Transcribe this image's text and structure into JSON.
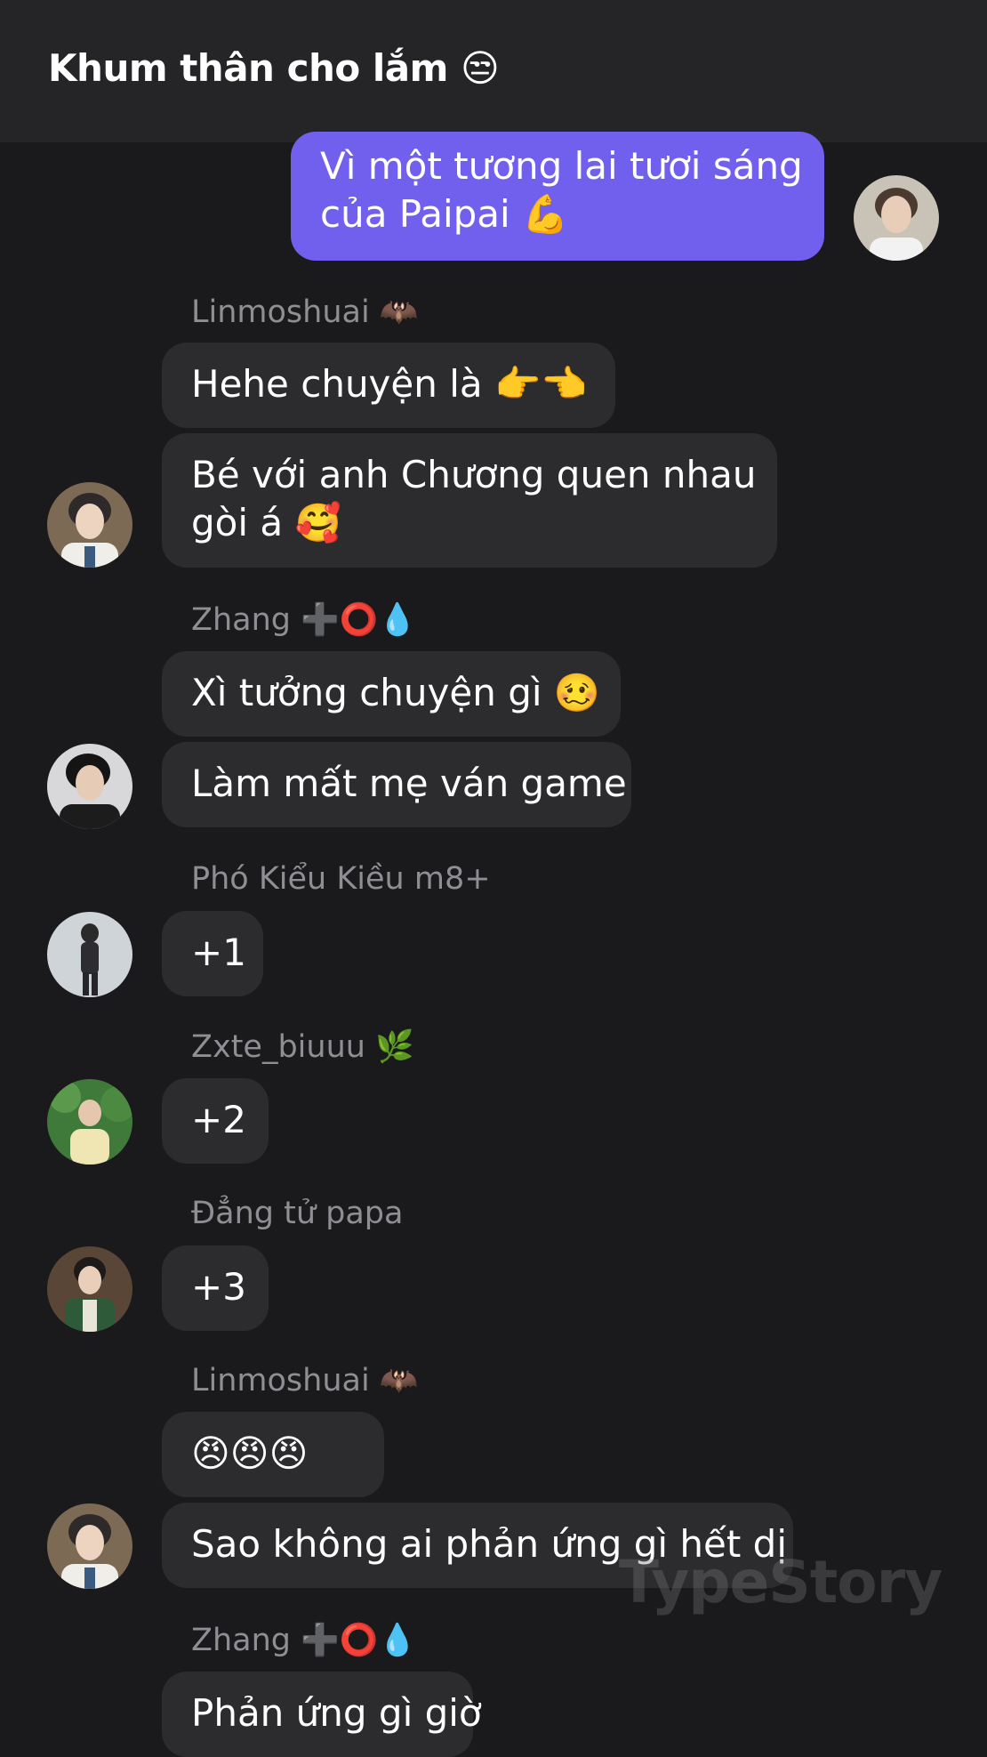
{
  "header": {
    "title": "Khum thân cho lắm 😒"
  },
  "messages": {
    "me1": {
      "line1": "Vì một tương lai tươi sáng",
      "line2": "của Paipai 💪"
    },
    "g1": {
      "sender": "Linmoshuai 🦇",
      "m1": "Hehe chuyện là 👉👈",
      "m2_line1": "Bé với anh Chương quen nhau",
      "m2_line2": "gòi á 🥰"
    },
    "g2": {
      "sender": "Zhang ➕⭕💧",
      "m1": "Xì tưởng chuyện gì 🥴",
      "m2": "Làm mất mẹ ván game"
    },
    "g3": {
      "sender": "Phó Kiểu Kiều m8+",
      "m1": "+1"
    },
    "g4": {
      "sender": "Zxte_biuuu 🌿",
      "m1": "+2"
    },
    "g5": {
      "sender": "Đẳng tử papa",
      "m1": "+3"
    },
    "g6": {
      "sender": "Linmoshuai 🦇",
      "m1": "😠😠😠",
      "m2": "Sao không ai phản ứng gì hết dị"
    },
    "g7": {
      "sender": "Zhang ➕⭕💧",
      "m1": "Phản ứng gì giờ"
    }
  },
  "watermark": "TypeStory",
  "colors": {
    "background": "#1a1a1c",
    "header": "#252527",
    "bubble_other": "#2c2c2e",
    "bubble_me": "#7160ee",
    "sender_name": "#8e8e93"
  }
}
